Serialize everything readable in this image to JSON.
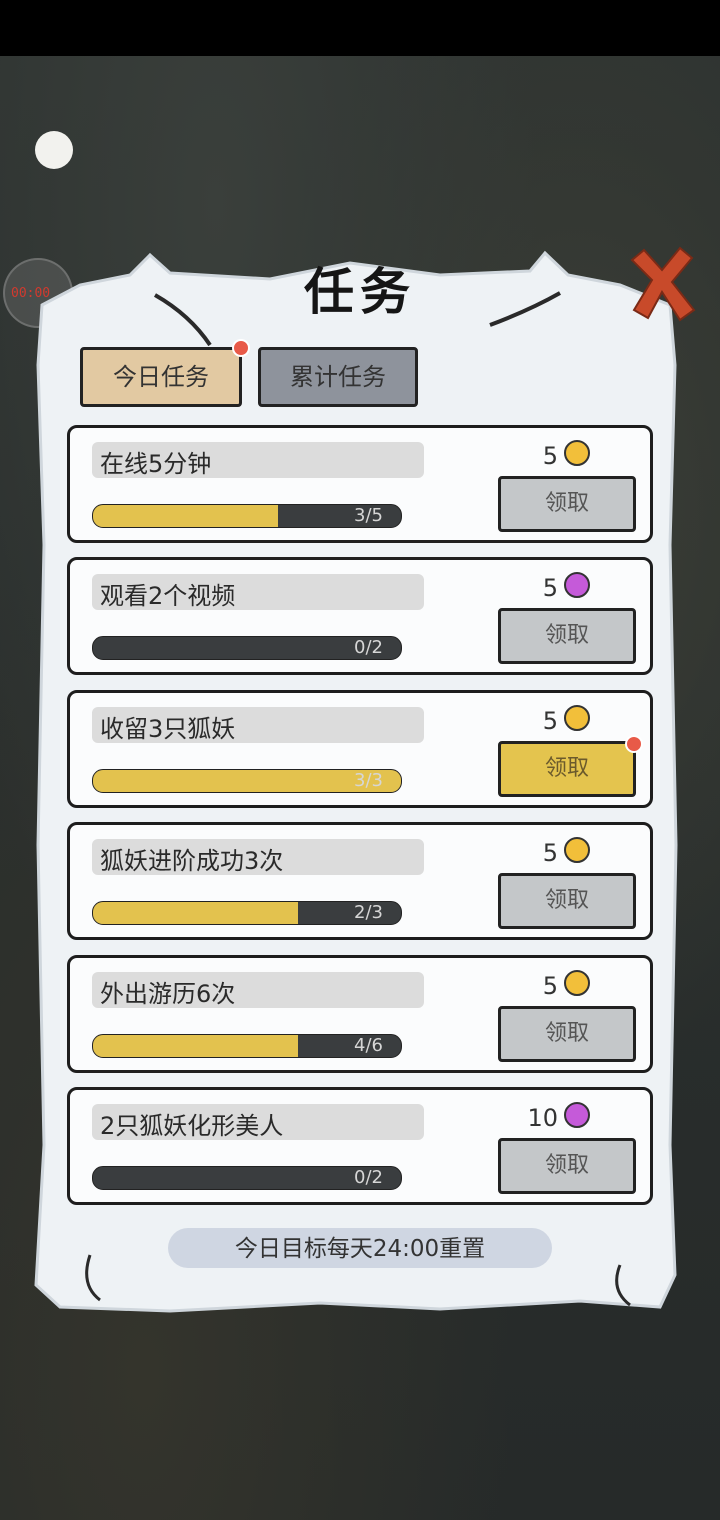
{
  "title": "任务",
  "side_badge": "00:00",
  "tabs": [
    {
      "label": "今日任务",
      "active": true,
      "has_dot": true
    },
    {
      "label": "累计任务",
      "active": false,
      "has_dot": false
    }
  ],
  "tasks": [
    {
      "name": "在线5分钟",
      "progress_text": "3/5",
      "progress": 0.6,
      "reward": "5",
      "reward_icon": "gold-coin-icon",
      "claim_label": "领取",
      "claimable": false
    },
    {
      "name": "观看2个视频",
      "progress_text": "0/2",
      "progress": 0.0,
      "reward": "5",
      "reward_icon": "purple-gem-icon",
      "claim_label": "领取",
      "claimable": false
    },
    {
      "name": "收留3只狐妖",
      "progress_text": "3/3",
      "progress": 1.0,
      "reward": "5",
      "reward_icon": "gold-coin-icon",
      "claim_label": "领取",
      "claimable": true
    },
    {
      "name": "狐妖进阶成功3次",
      "progress_text": "2/3",
      "progress": 0.667,
      "reward": "5",
      "reward_icon": "gold-coin-icon",
      "claim_label": "领取",
      "claimable": false
    },
    {
      "name": "外出游历6次",
      "progress_text": "4/6",
      "progress": 0.667,
      "reward": "5",
      "reward_icon": "gold-coin-icon",
      "claim_label": "领取",
      "claimable": false
    },
    {
      "name": "2只狐妖化形美人",
      "progress_text": "0/2",
      "progress": 0.0,
      "reward": "10",
      "reward_icon": "purple-gem-icon",
      "claim_label": "领取",
      "claimable": false
    }
  ],
  "footer": "今日目标每天24:00重置",
  "colors": {
    "progress_fill": "#e3c24e",
    "claim_active": "#e4c44e",
    "notification_dot": "#e85a48",
    "close_x": "#c84a2a"
  }
}
